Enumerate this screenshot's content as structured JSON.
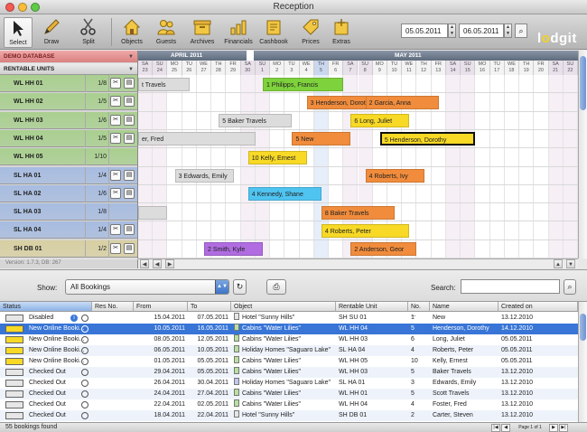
{
  "window": {
    "title": "Reception"
  },
  "toolbar": {
    "tools": [
      {
        "label": "Select",
        "icon": "cursor-icon"
      },
      {
        "label": "Draw",
        "icon": "pencil-icon"
      },
      {
        "label": "Split",
        "icon": "scissors-icon"
      },
      {
        "label": "Objects",
        "icon": "house-icon"
      },
      {
        "label": "Guests",
        "icon": "people-icon"
      },
      {
        "label": "Archives",
        "icon": "archive-icon"
      },
      {
        "label": "Financials",
        "icon": "chart-icon"
      },
      {
        "label": "Cashbook",
        "icon": "cashbook-icon"
      },
      {
        "label": "Prices",
        "icon": "price-tag-icon"
      },
      {
        "label": "Extras",
        "icon": "extras-icon"
      }
    ],
    "date_from": "05.05.2011",
    "date_to": "06.05.2011",
    "logo": "lodgit"
  },
  "sidebar": {
    "database": "DEMO DATABASE",
    "filter": "RENTABLE UNITS",
    "units": [
      {
        "name": "WL HH 01",
        "cap": "1/8",
        "group": "green"
      },
      {
        "name": "WL HH 02",
        "cap": "1/5",
        "group": "green"
      },
      {
        "name": "WL HH 03",
        "cap": "1/6",
        "group": "green"
      },
      {
        "name": "WL HH 04",
        "cap": "1/5",
        "group": "green"
      },
      {
        "name": "WL HH 05",
        "cap": "1/10",
        "group": "green"
      },
      {
        "name": "SL HA 01",
        "cap": "1/4",
        "group": "blue"
      },
      {
        "name": "SL HA 02",
        "cap": "1/6",
        "group": "blue"
      },
      {
        "name": "SL HA 03",
        "cap": "1/8",
        "group": "blue"
      },
      {
        "name": "SL HA 04",
        "cap": "1/4",
        "group": "blue"
      },
      {
        "name": "SH DB 01",
        "cap": "1/2",
        "group": "khaki"
      }
    ],
    "version": "Version: 1.7.3, DB: 267"
  },
  "calendar": {
    "months": [
      {
        "label": "APRIL 2011"
      },
      {
        "label": "MAY 2011"
      }
    ],
    "days": [
      {
        "d": "SA",
        "n": "23",
        "t": "we"
      },
      {
        "d": "SU",
        "n": "24",
        "t": "we"
      },
      {
        "d": "MO",
        "n": "25",
        "t": ""
      },
      {
        "d": "TU",
        "n": "26",
        "t": ""
      },
      {
        "d": "WE",
        "n": "27",
        "t": ""
      },
      {
        "d": "TH",
        "n": "28",
        "t": ""
      },
      {
        "d": "FR",
        "n": "29",
        "t": ""
      },
      {
        "d": "SA",
        "n": "30",
        "t": "we"
      },
      {
        "d": "SU",
        "n": "1",
        "t": "we"
      },
      {
        "d": "MO",
        "n": "2",
        "t": ""
      },
      {
        "d": "TU",
        "n": "3",
        "t": ""
      },
      {
        "d": "WE",
        "n": "4",
        "t": ""
      },
      {
        "d": "TH",
        "n": "5",
        "t": "today"
      },
      {
        "d": "FR",
        "n": "6",
        "t": ""
      },
      {
        "d": "SA",
        "n": "7",
        "t": "we"
      },
      {
        "d": "SU",
        "n": "8",
        "t": "we"
      },
      {
        "d": "MO",
        "n": "9",
        "t": ""
      },
      {
        "d": "TU",
        "n": "10",
        "t": ""
      },
      {
        "d": "WE",
        "n": "11",
        "t": ""
      },
      {
        "d": "TH",
        "n": "12",
        "t": ""
      },
      {
        "d": "FR",
        "n": "13",
        "t": ""
      },
      {
        "d": "SA",
        "n": "14",
        "t": "we"
      },
      {
        "d": "SU",
        "n": "15",
        "t": "we"
      },
      {
        "d": "MO",
        "n": "16",
        "t": ""
      },
      {
        "d": "TU",
        "n": "17",
        "t": ""
      },
      {
        "d": "WE",
        "n": "18",
        "t": ""
      },
      {
        "d": "TH",
        "n": "19",
        "t": ""
      },
      {
        "d": "FR",
        "n": "20",
        "t": ""
      },
      {
        "d": "SA",
        "n": "21",
        "t": "we"
      },
      {
        "d": "SU",
        "n": "22",
        "t": "we"
      }
    ],
    "bookings": [
      {
        "label": "t Travels",
        "row": 0,
        "start": 0,
        "len": 3.5,
        "color": "#dcdcdc"
      },
      {
        "label": "1 Philipps, Francis",
        "row": 0,
        "start": 8.5,
        "len": 5.5,
        "color": "#7ed23c"
      },
      {
        "label": "3 Henderson, Doroth",
        "row": 1,
        "start": 11.5,
        "len": 4.5,
        "color": "#f08c3c"
      },
      {
        "label": "2 Garcia, Anna",
        "row": 1,
        "start": 15.5,
        "len": 5,
        "color": "#f08c3c"
      },
      {
        "label": "5 Baker Travels",
        "row": 2,
        "start": 5.5,
        "len": 5,
        "color": "#dcdcdc"
      },
      {
        "label": "6 Long, Juliet",
        "row": 2,
        "start": 14.5,
        "len": 4,
        "color": "#f7d926"
      },
      {
        "label": "er, Fred",
        "row": 3,
        "start": 0,
        "len": 8,
        "color": "#dcdcdc"
      },
      {
        "label": "5 New",
        "row": 3,
        "start": 10.5,
        "len": 4,
        "color": "#f08c3c"
      },
      {
        "label": "5 Henderson, Dorothy",
        "row": 3,
        "start": 16.5,
        "len": 6.5,
        "color": "#f7d926",
        "outlined": true
      },
      {
        "label": "10 Kelly, Ernest",
        "row": 4,
        "start": 7.5,
        "len": 4,
        "color": "#f7d926"
      },
      {
        "label": "3 Edwards, Emily",
        "row": 5,
        "start": 2.5,
        "len": 4,
        "color": "#dcdcdc"
      },
      {
        "label": "4 Roberts, Ivy",
        "row": 5,
        "start": 15.5,
        "len": 4,
        "color": "#f08c3c"
      },
      {
        "label": "4 Kennedy, Shane",
        "row": 6,
        "start": 7.5,
        "len": 5,
        "color": "#4fc4f0"
      },
      {
        "label": "8 Baker Travels",
        "row": 7,
        "start": 12.5,
        "len": 5,
        "color": "#f08c3c"
      },
      {
        "label": "",
        "row": 7,
        "start": 0,
        "len": 2,
        "color": "#dcdcdc"
      },
      {
        "label": "4 Roberts, Peter",
        "row": 8,
        "start": 12.5,
        "len": 6,
        "color": "#f7d926"
      },
      {
        "label": "2 Smith, Kyle",
        "row": 9,
        "start": 4.5,
        "len": 4,
        "color": "#b06ce0"
      },
      {
        "label": "2 Anderson, Geor",
        "row": 9,
        "start": 14.5,
        "len": 4.5,
        "color": "#f08c3c"
      }
    ]
  },
  "filterbar": {
    "show_label": "Show:",
    "show_value": "All Bookings",
    "search_label": "Search:",
    "search_value": ""
  },
  "table": {
    "columns": [
      "Status",
      "Res No.",
      "From",
      "To",
      "Object",
      "Rentable Unit",
      "No. ...",
      "Name",
      "Created on"
    ],
    "rows": [
      {
        "status": "Disabled",
        "sw": "#e6e6e6",
        "badge": "i",
        "resno": "",
        "from": "15.04.2011",
        "to": "07.05.2011",
        "objsw": "#e6e6e6",
        "object": "Hotel \"Sunny Hills\"",
        "unit": "SH SU 01",
        "no": "1",
        "name": "New",
        "created": "13.12.2010"
      },
      {
        "status": "New Online Booki...",
        "sw": "#f7d926",
        "badge": "",
        "resno": "",
        "from": "10.05.2011",
        "to": "16.05.2011",
        "objsw": "#b8e0a0",
        "object": "Cabins \"Water Lilies\"",
        "unit": "WL HH 04",
        "no": "5",
        "name": "Henderson, Dorothy",
        "created": "14.12.2010",
        "selected": true
      },
      {
        "status": "New Online Booki...",
        "sw": "#f7d926",
        "badge": "",
        "resno": "",
        "from": "08.05.2011",
        "to": "12.05.2011",
        "objsw": "#b8e0a0",
        "object": "Cabins \"Water Lilies\"",
        "unit": "WL HH 03",
        "no": "6",
        "name": "Long, Juliet",
        "created": "05.05.2011"
      },
      {
        "status": "New Online Booki...",
        "sw": "#f7d926",
        "badge": "",
        "resno": "",
        "from": "06.05.2011",
        "to": "10.05.2011",
        "objsw": "#b8e0a0",
        "object": "Holiday Homes \"Saguaro Lake\"",
        "unit": "SL HA 04",
        "no": "4",
        "name": "Roberts, Peter",
        "created": "05.05.2011"
      },
      {
        "status": "New Online Booki...",
        "sw": "#f7d926",
        "badge": "",
        "resno": "",
        "from": "01.05.2011",
        "to": "05.05.2011",
        "objsw": "#b8e0a0",
        "object": "Cabins \"Water Lilies\"",
        "unit": "WL HH 05",
        "no": "10",
        "name": "Kelly, Ernest",
        "created": "05.05.2011"
      },
      {
        "status": "Checked Out",
        "sw": "#e6e6e6",
        "badge": "",
        "resno": "",
        "from": "29.04.2011",
        "to": "05.05.2011",
        "objsw": "#b8e0a0",
        "object": "Cabins \"Water Lilies\"",
        "unit": "WL HH 03",
        "no": "5",
        "name": "Baker Travels",
        "created": "13.12.2010"
      },
      {
        "status": "Checked Out",
        "sw": "#e6e6e6",
        "badge": "",
        "resno": "",
        "from": "26.04.2011",
        "to": "30.04.2011",
        "objsw": "#c0c8f0",
        "object": "Holiday Homes \"Saguaro Lake\"",
        "unit": "SL HA 01",
        "no": "3",
        "name": "Edwards, Emily",
        "created": "13.12.2010"
      },
      {
        "status": "Checked Out",
        "sw": "#e6e6e6",
        "badge": "",
        "resno": "",
        "from": "24.04.2011",
        "to": "27.04.2011",
        "objsw": "#b8e0a0",
        "object": "Cabins \"Water Lilies\"",
        "unit": "WL HH 01",
        "no": "5",
        "name": "Scott Travels",
        "created": "13.12.2010"
      },
      {
        "status": "Checked Out",
        "sw": "#e6e6e6",
        "badge": "",
        "resno": "",
        "from": "22.04.2011",
        "to": "02.05.2011",
        "objsw": "#b8e0a0",
        "object": "Cabins \"Water Lilies\"",
        "unit": "WL HH 04",
        "no": "4",
        "name": "Foster, Fred",
        "created": "13.12.2010"
      },
      {
        "status": "Checked Out",
        "sw": "#e6e6e6",
        "badge": "",
        "resno": "",
        "from": "18.04.2011",
        "to": "22.04.2011",
        "objsw": "#e6e6e6",
        "object": "Hotel \"Sunny Hills\"",
        "unit": "SH DB 01",
        "no": "2",
        "name": "Carter, Steven",
        "created": "13.12.2010"
      }
    ]
  },
  "status": {
    "count": "55 bookings found",
    "page": "Page 1 of 1"
  },
  "colors": {
    "green_row": "#a9cf8f",
    "blue_row": "#a7bce0",
    "khaki_row": "#d8d0a2",
    "selection": "#3875d7"
  }
}
